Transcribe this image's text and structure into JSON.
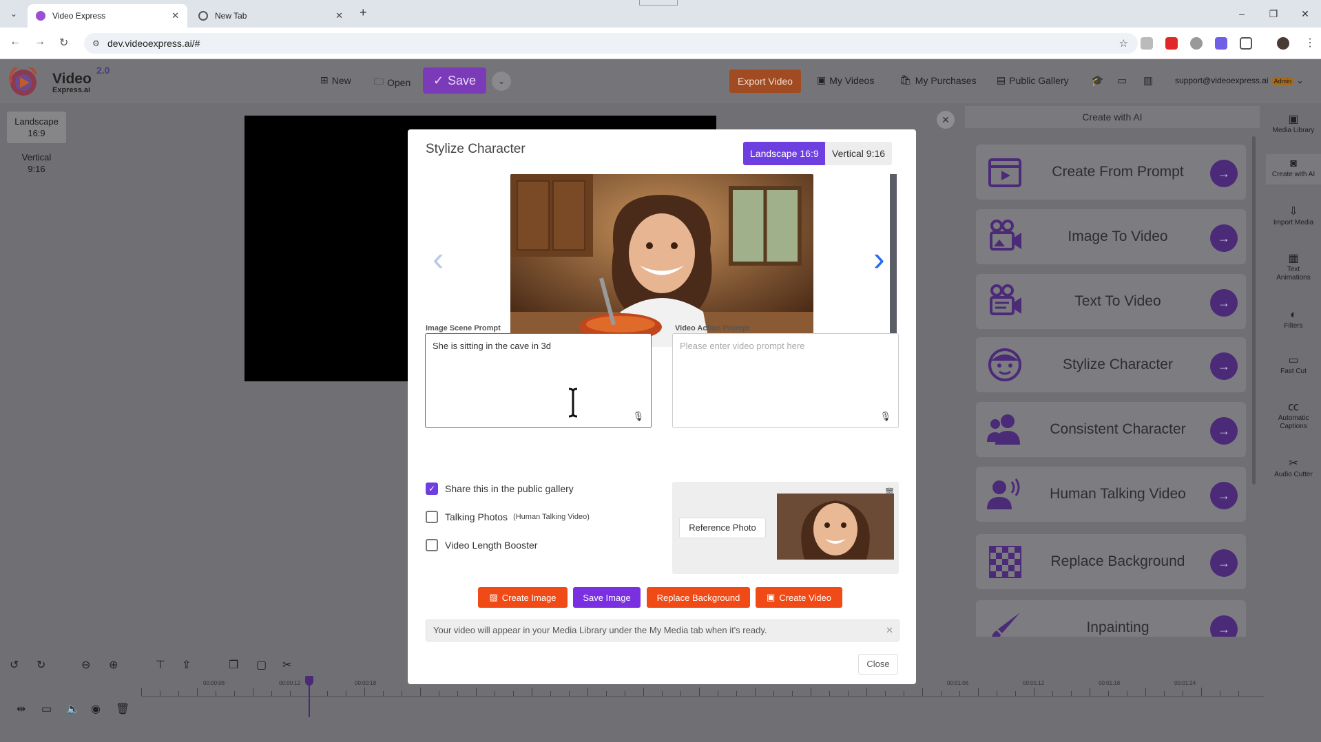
{
  "browser": {
    "tabs": [
      {
        "title": "Video Express",
        "active": true
      },
      {
        "title": "New Tab",
        "active": false
      }
    ],
    "url": "dev.videoexpress.ai/#"
  },
  "header": {
    "logo_text": "Video",
    "logo_subtext": "Express.ai",
    "logo_version": "2.0",
    "new_label": "New",
    "open_label": "Open",
    "save_label": "Save",
    "export_label": "Export Video",
    "my_videos_label": "My Videos",
    "my_purchases_label": "My Purchases",
    "public_gallery_label": "Public Gallery",
    "account_email": "support@videoexpress.ai",
    "account_badge": "Admin"
  },
  "canvas_formats": [
    {
      "label": "Landscape 16:9",
      "line1": "Landscape",
      "line2": "16:9",
      "selected": true
    },
    {
      "label": "Vertical 9:16",
      "line1": "Vertical",
      "line2": "9:16",
      "selected": false
    }
  ],
  "modal": {
    "title": "Stylize Character",
    "format_options": [
      "Landscape 16:9",
      "Vertical 9:16"
    ],
    "selected_format": "Landscape 16:9",
    "image_prompt_label": "Image Scene Prompt",
    "image_prompt_value": "She is sitting in the cave in 3d",
    "video_prompt_label": "Video Action Prompt",
    "video_prompt_placeholder": "Please enter video prompt here",
    "checkboxes": [
      {
        "label": "Share this in the public gallery",
        "note": "",
        "checked": true
      },
      {
        "label": "Talking Photos",
        "note": "(Human Talking Video)",
        "checked": false
      },
      {
        "label": "Video Length Booster",
        "note": "",
        "checked": false
      }
    ],
    "reference_photo_label": "Reference Photo",
    "actions": {
      "create_image": "Create Image",
      "save_image": "Save Image",
      "replace_background": "Replace Background",
      "create_video": "Create Video"
    },
    "notice": "Your video will appear in your Media Library under the My Media tab when it's ready.",
    "close_label": "Close"
  },
  "ai_panel": {
    "title": "Create with AI",
    "items": [
      {
        "label": "Create From Prompt",
        "icon": "film-icon"
      },
      {
        "label": "Image To Video",
        "icon": "camera-image-icon"
      },
      {
        "label": "Text To Video",
        "icon": "camera-text-icon"
      },
      {
        "label": "Stylize Character",
        "icon": "face-icon"
      },
      {
        "label": "Consistent Character",
        "icon": "users-icon"
      },
      {
        "label": "Human Talking Video",
        "icon": "speaking-person-icon"
      },
      {
        "label": "Replace Background",
        "icon": "checkerboard-icon"
      },
      {
        "label": "Inpainting",
        "icon": "brush-icon"
      }
    ]
  },
  "side_nav": [
    {
      "label": "Media Library",
      "icon": "media-library-icon"
    },
    {
      "label": "Create with AI",
      "icon": "robot-icon",
      "selected": true
    },
    {
      "label": "Import Media",
      "icon": "import-icon"
    },
    {
      "label": "Text Animations",
      "icon": "text-animation-icon"
    },
    {
      "label": "Filters",
      "icon": "filter-icon"
    },
    {
      "label": "Fast Cut",
      "icon": "fast-cut-icon"
    },
    {
      "label": "Automatic Captions",
      "icon": "captions-icon"
    },
    {
      "label": "Audio Cutter",
      "icon": "scissors-icon"
    }
  ],
  "timeline": {
    "labels": [
      "00:00:06",
      "00:00:12",
      "00:00:18",
      "00:01:06",
      "00:01:12",
      "00:01:18",
      "00:01:24"
    ]
  },
  "colors": {
    "brand_purple": "#6d3fe0",
    "action_orange": "#f04b16",
    "save_purple": "#7a2fe0"
  }
}
